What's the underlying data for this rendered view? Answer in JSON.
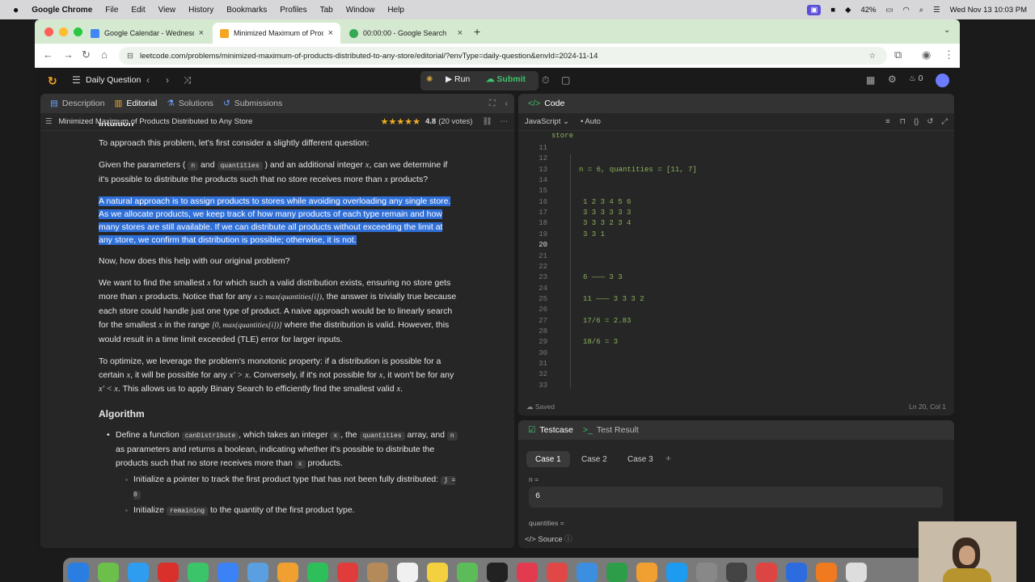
{
  "menubar": {
    "app": "Google Chrome",
    "items": [
      "File",
      "Edit",
      "View",
      "History",
      "Bookmarks",
      "Profiles",
      "Tab",
      "Window",
      "Help"
    ],
    "battery": "42%",
    "datetime": "Wed Nov 13  10:03 PM"
  },
  "tabs": [
    {
      "title": "Google Calendar - Wednesday",
      "color": "#4285f4"
    },
    {
      "title": "Minimized Maximum of Products",
      "color": "#f5a623"
    },
    {
      "title": "00:00:00 - Google Search",
      "color": "#34a853"
    }
  ],
  "url": "leetcode.com/problems/minimized-maximum-of-products-distributed-to-any-store/editorial/?envType=daily-question&envId=2024-11-14",
  "topbar": {
    "daily": "Daily Question",
    "run": "Run",
    "submit": "Submit",
    "streak": "0"
  },
  "left": {
    "tabs": [
      "Description",
      "Editorial",
      "Solutions",
      "Submissions"
    ],
    "problem_title": "Minimized Maximum of Products Distributed to Any Store",
    "rating": "4.8",
    "votes": "(20 votes)",
    "cut_heading": "Intuition",
    "p1": "To approach this problem, let's first consider a slightly different question:",
    "p2": {
      "a": "Given the parameters (",
      "c1": "n",
      "b": "and",
      "c2": "quantities",
      "c": ") and an additional integer",
      "x": "x",
      "d": ", can we determine if it's possible to distribute the products such that no store receives more than",
      "x2": "x",
      "e": "products?"
    },
    "p3": "A natural approach is to assign products to stores while avoiding overloading any single store. As we allocate products, we keep track of how many products of each type remain and how many stores are still available. If we can distribute all products without exceeding the limit at any store, we confirm that distribution is possible; otherwise, it is not.",
    "p4": "Now, how does this help with our original problem?",
    "p5": {
      "a": "We want to find the smallest",
      "x": "x",
      "b": "for which such a valid distribution exists, ensuring no store gets more than",
      "x2": "x",
      "c": "products. Notice that for any",
      "m1": "x ≥ max(quantities[i])",
      "d": ", the answer is trivially true because each store could handle just one type of product. A naive approach would be to linearly search for the smallest",
      "x3": "x",
      "e": "in the range",
      "m2": "[0, max(quantities[i])]",
      "f": "where the distribution is valid. However, this would result in a time limit exceeded (TLE) error for larger inputs."
    },
    "p6": {
      "a": "To optimize, we leverage the problem's monotonic property: if a distribution is possible for a certain",
      "x": "x",
      "b": ", it will be possible for any",
      "m1": "x′ > x",
      "c": ". Conversely, if it's not possible for",
      "x2": "x",
      "d": ", it won't be for any",
      "m2": "x′ < x",
      "e": ". This allows us to apply Binary Search to efficiently find the smallest valid",
      "x3": "x",
      "f": "."
    },
    "algo_heading": "Algorithm",
    "b1": {
      "a": "Define a function",
      "c1": "canDistribute",
      "b": ", which takes an integer",
      "c2": "x",
      "c": ", the",
      "c3": "quantities",
      "d": "array, and",
      "c4": "n",
      "e": "as parameters and returns a boolean, indicating whether it's possible to distribute the products such that no store receives more than",
      "c5": "x",
      "f": "products."
    },
    "s1": {
      "a": "Initialize a pointer to track the first product type that has not been fully distributed:",
      "c": "j = 0"
    },
    "s2": {
      "a": "Initialize",
      "c": "remaining",
      "b": "to the quantity of the first product type."
    }
  },
  "right": {
    "code_tab": "Code",
    "lang": "JavaScript",
    "mode": "Auto",
    "saved": "Saved",
    "cursor": "Ln 20, Col 1",
    "line_numbers": [
      "11",
      "12",
      "13",
      "14",
      "15",
      "16",
      "17",
      "18",
      "19",
      "20",
      "21",
      "22",
      "23",
      "24",
      "25",
      "26",
      "27",
      "28",
      "29",
      "30",
      "31",
      "32",
      "33"
    ],
    "first_line": "store",
    "lines": [
      {
        "n": 2,
        "t": "n = 6, quantities = [11, 7]",
        "indent": 1
      },
      {
        "n": 5,
        "t": "1 2 3 4 5 6",
        "indent": 2
      },
      {
        "n": 6,
        "t": "3 3 3 3 3 3",
        "indent": 2
      },
      {
        "n": 7,
        "t": "3 3 3 2 3 4",
        "indent": 2
      },
      {
        "n": 8,
        "t": "3 3 1",
        "indent": 2
      },
      {
        "n": 12,
        "t": "6 ——— 3 3",
        "indent": 2
      },
      {
        "n": 14,
        "t": "11 ——— 3 3 3 2",
        "indent": 2
      },
      {
        "n": 16,
        "t": "17/6 = 2.83",
        "indent": 2
      },
      {
        "n": 18,
        "t": "18/6 = 3",
        "indent": 2
      }
    ]
  },
  "testcase": {
    "tab1": "Testcase",
    "tab2": "Test Result",
    "cases": [
      "Case 1",
      "Case 2",
      "Case 3"
    ],
    "n_label": "n =",
    "n_value": "6",
    "q_label": "quantities =",
    "source": "Source"
  }
}
